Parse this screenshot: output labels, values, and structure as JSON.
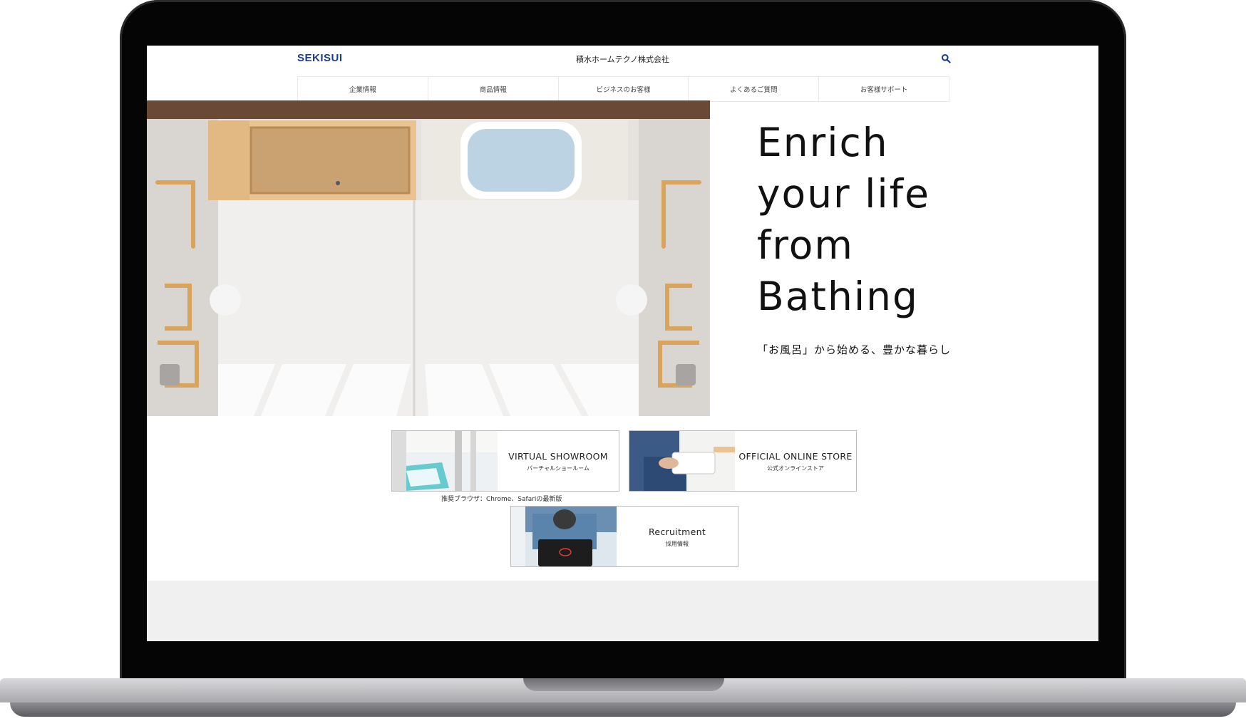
{
  "header": {
    "logo": "SEKISUI",
    "company_name": "積水ホームテクノ株式会社"
  },
  "nav": [
    {
      "label": "企業情報"
    },
    {
      "label": "商品情報"
    },
    {
      "label": "ビジネスのお客様"
    },
    {
      "label": "よくあるご質問"
    },
    {
      "label": "お客様サポート"
    }
  ],
  "hero": {
    "headline": "Enrich\nyour life\nfrom\nBathing",
    "subcopy": "「お風呂」から始める、豊かな暮らし"
  },
  "banners": {
    "showroom": {
      "title": "VIRTUAL SHOWROOM",
      "subtitle": "バーチャルショールーム"
    },
    "store": {
      "title": "OFFICIAL ONLINE STORE",
      "subtitle": "公式オンラインストア"
    },
    "recruit": {
      "title": "Recruitment",
      "subtitle": "採用情報"
    }
  },
  "browser_note": "推奨ブラウザ：Chrome、Safariの最新版",
  "colors": {
    "brand": "#1b3c93",
    "handrail": "#d9a45c",
    "tub_blue": "#bcd3e3"
  }
}
